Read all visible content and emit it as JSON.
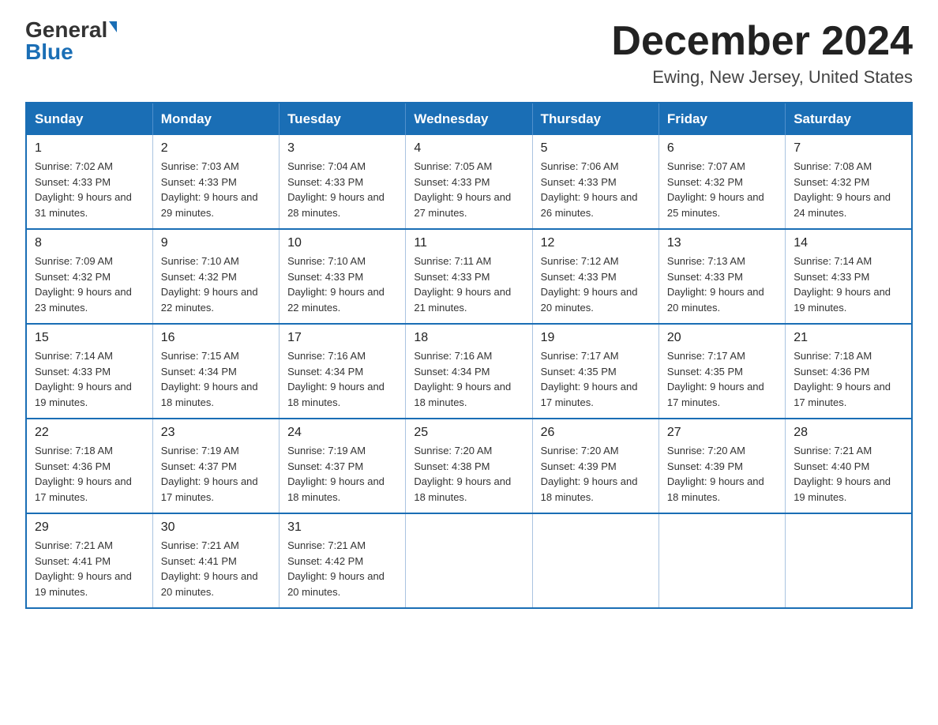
{
  "header": {
    "logo_general": "General",
    "logo_blue": "Blue",
    "title": "December 2024",
    "subtitle": "Ewing, New Jersey, United States"
  },
  "days_of_week": [
    "Sunday",
    "Monday",
    "Tuesday",
    "Wednesday",
    "Thursday",
    "Friday",
    "Saturday"
  ],
  "weeks": [
    [
      {
        "day": "1",
        "sunrise": "7:02 AM",
        "sunset": "4:33 PM",
        "daylight": "9 hours and 31 minutes."
      },
      {
        "day": "2",
        "sunrise": "7:03 AM",
        "sunset": "4:33 PM",
        "daylight": "9 hours and 29 minutes."
      },
      {
        "day": "3",
        "sunrise": "7:04 AM",
        "sunset": "4:33 PM",
        "daylight": "9 hours and 28 minutes."
      },
      {
        "day": "4",
        "sunrise": "7:05 AM",
        "sunset": "4:33 PM",
        "daylight": "9 hours and 27 minutes."
      },
      {
        "day": "5",
        "sunrise": "7:06 AM",
        "sunset": "4:33 PM",
        "daylight": "9 hours and 26 minutes."
      },
      {
        "day": "6",
        "sunrise": "7:07 AM",
        "sunset": "4:32 PM",
        "daylight": "9 hours and 25 minutes."
      },
      {
        "day": "7",
        "sunrise": "7:08 AM",
        "sunset": "4:32 PM",
        "daylight": "9 hours and 24 minutes."
      }
    ],
    [
      {
        "day": "8",
        "sunrise": "7:09 AM",
        "sunset": "4:32 PM",
        "daylight": "9 hours and 23 minutes."
      },
      {
        "day": "9",
        "sunrise": "7:10 AM",
        "sunset": "4:32 PM",
        "daylight": "9 hours and 22 minutes."
      },
      {
        "day": "10",
        "sunrise": "7:10 AM",
        "sunset": "4:33 PM",
        "daylight": "9 hours and 22 minutes."
      },
      {
        "day": "11",
        "sunrise": "7:11 AM",
        "sunset": "4:33 PM",
        "daylight": "9 hours and 21 minutes."
      },
      {
        "day": "12",
        "sunrise": "7:12 AM",
        "sunset": "4:33 PM",
        "daylight": "9 hours and 20 minutes."
      },
      {
        "day": "13",
        "sunrise": "7:13 AM",
        "sunset": "4:33 PM",
        "daylight": "9 hours and 20 minutes."
      },
      {
        "day": "14",
        "sunrise": "7:14 AM",
        "sunset": "4:33 PM",
        "daylight": "9 hours and 19 minutes."
      }
    ],
    [
      {
        "day": "15",
        "sunrise": "7:14 AM",
        "sunset": "4:33 PM",
        "daylight": "9 hours and 19 minutes."
      },
      {
        "day": "16",
        "sunrise": "7:15 AM",
        "sunset": "4:34 PM",
        "daylight": "9 hours and 18 minutes."
      },
      {
        "day": "17",
        "sunrise": "7:16 AM",
        "sunset": "4:34 PM",
        "daylight": "9 hours and 18 minutes."
      },
      {
        "day": "18",
        "sunrise": "7:16 AM",
        "sunset": "4:34 PM",
        "daylight": "9 hours and 18 minutes."
      },
      {
        "day": "19",
        "sunrise": "7:17 AM",
        "sunset": "4:35 PM",
        "daylight": "9 hours and 17 minutes."
      },
      {
        "day": "20",
        "sunrise": "7:17 AM",
        "sunset": "4:35 PM",
        "daylight": "9 hours and 17 minutes."
      },
      {
        "day": "21",
        "sunrise": "7:18 AM",
        "sunset": "4:36 PM",
        "daylight": "9 hours and 17 minutes."
      }
    ],
    [
      {
        "day": "22",
        "sunrise": "7:18 AM",
        "sunset": "4:36 PM",
        "daylight": "9 hours and 17 minutes."
      },
      {
        "day": "23",
        "sunrise": "7:19 AM",
        "sunset": "4:37 PM",
        "daylight": "9 hours and 17 minutes."
      },
      {
        "day": "24",
        "sunrise": "7:19 AM",
        "sunset": "4:37 PM",
        "daylight": "9 hours and 18 minutes."
      },
      {
        "day": "25",
        "sunrise": "7:20 AM",
        "sunset": "4:38 PM",
        "daylight": "9 hours and 18 minutes."
      },
      {
        "day": "26",
        "sunrise": "7:20 AM",
        "sunset": "4:39 PM",
        "daylight": "9 hours and 18 minutes."
      },
      {
        "day": "27",
        "sunrise": "7:20 AM",
        "sunset": "4:39 PM",
        "daylight": "9 hours and 18 minutes."
      },
      {
        "day": "28",
        "sunrise": "7:21 AM",
        "sunset": "4:40 PM",
        "daylight": "9 hours and 19 minutes."
      }
    ],
    [
      {
        "day": "29",
        "sunrise": "7:21 AM",
        "sunset": "4:41 PM",
        "daylight": "9 hours and 19 minutes."
      },
      {
        "day": "30",
        "sunrise": "7:21 AM",
        "sunset": "4:41 PM",
        "daylight": "9 hours and 20 minutes."
      },
      {
        "day": "31",
        "sunrise": "7:21 AM",
        "sunset": "4:42 PM",
        "daylight": "9 hours and 20 minutes."
      },
      null,
      null,
      null,
      null
    ]
  ]
}
